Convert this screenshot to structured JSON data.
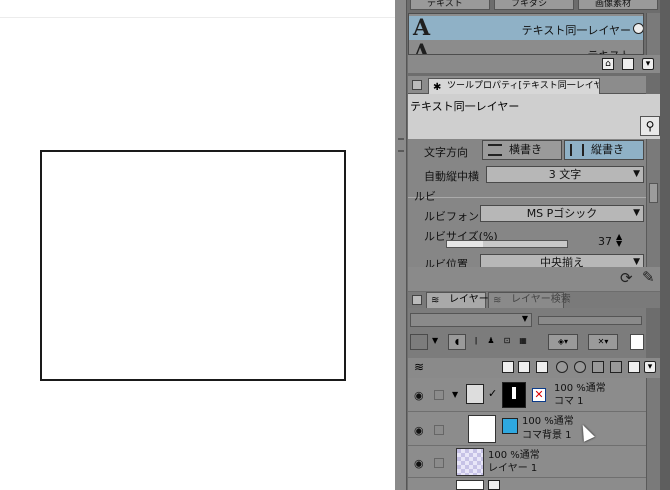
{
  "material_tabs": [
    "テキスト",
    "フキダシ",
    "画像素材"
  ],
  "material_list": {
    "items": [
      {
        "icon": "A",
        "name": "テキスト同一レイヤー"
      },
      {
        "icon": "A",
        "name": "テキスト"
      }
    ]
  },
  "tool_property": {
    "tab_label": "ツールプロパティ[テキスト同一レイヤー]",
    "title": "テキスト同一レイヤー",
    "text_direction_label": "文字方向",
    "horizontal_label": "横書き",
    "vertical_label": "縦書き",
    "auto_tcy_label": "自動縦中横",
    "auto_tcy_value": "3 文字",
    "ruby_section": "ルビ",
    "ruby_font_label": "ルビフォント",
    "ruby_font_value": "MS Pゴシック",
    "ruby_size_label": "ルビサイズ(%)",
    "ruby_size_value": "37",
    "ruby_size_fraction": 0.3,
    "ruby_position_label": "ルビ位置",
    "ruby_position_value": "中央揃え"
  },
  "layer_panel": {
    "tab_layer": "レイヤー",
    "tab_search": "レイヤー検索",
    "layers": [
      {
        "opacity_mode": "100 %通常",
        "name": "コマ 1"
      },
      {
        "opacity_mode": "100 %通常",
        "name": "コマ背景 1"
      },
      {
        "opacity_mode": "100 %通常",
        "name": "レイヤー 1"
      }
    ]
  },
  "colors": {
    "panel_bg": "#6d6d6d",
    "selected_row": "#8fb1c6",
    "vertical_selected": "#8fb1c6"
  }
}
